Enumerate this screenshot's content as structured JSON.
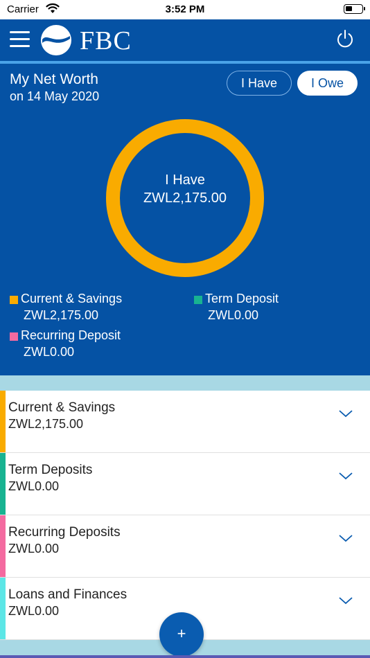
{
  "status_bar": {
    "carrier": "Carrier",
    "time": "3:52 PM"
  },
  "header": {
    "logo_text": "FBC"
  },
  "networth": {
    "title": "My Net Worth",
    "date": "on 14 May 2020",
    "toggle_have": "I Have",
    "toggle_owe": "I Owe",
    "donut_label": "I Have",
    "donut_amount": "ZWL2,175.00",
    "legend": [
      {
        "name": "Current & Savings",
        "value": "ZWL2,175.00",
        "color": "#f9ab00"
      },
      {
        "name": "Term Deposit",
        "value": "ZWL0.00",
        "color": "#18b391"
      },
      {
        "name": "Recurring Deposit",
        "value": "ZWL0.00",
        "color": "#f46aa0"
      }
    ]
  },
  "accounts": [
    {
      "name": "Current & Savings",
      "value": "ZWL2,175.00",
      "color": "#f9ab00"
    },
    {
      "name": "Term Deposits",
      "value": "ZWL0.00",
      "color": "#18b391"
    },
    {
      "name": "Recurring Deposits",
      "value": "ZWL0.00",
      "color": "#f46aa0"
    },
    {
      "name": "Loans and Finances",
      "value": "ZWL0.00",
      "color": "#5ce6e6"
    }
  ],
  "fab": {
    "label": "+"
  },
  "colors": {
    "primary": "#0552a4",
    "accent_light": "#4aa3e8",
    "background": "#a8d8e4",
    "donut_ring": "#f9ab00"
  }
}
